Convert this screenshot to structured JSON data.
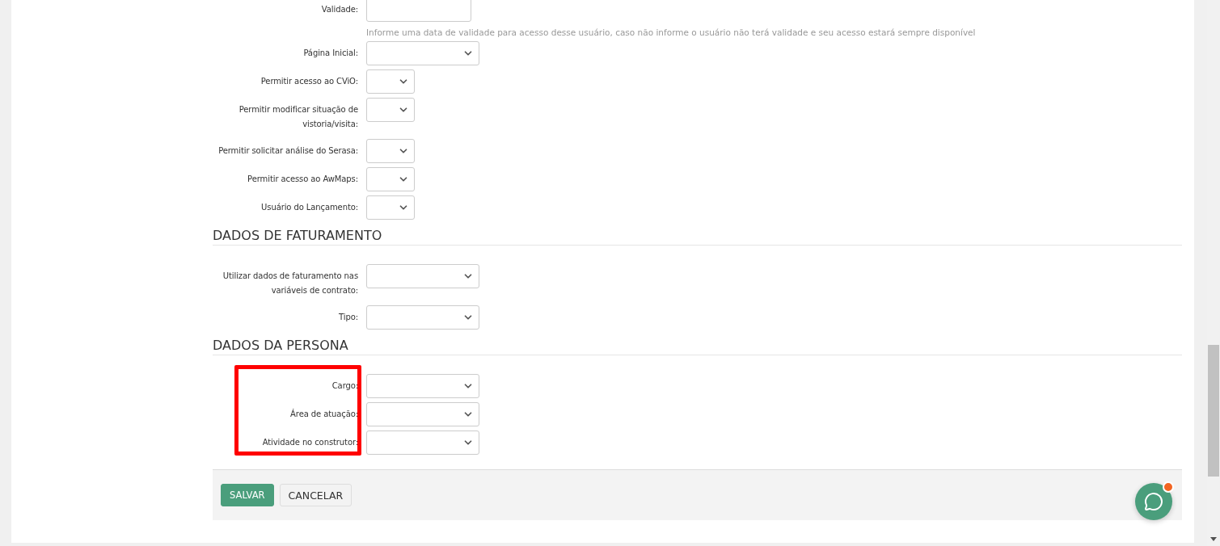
{
  "user_fields": [
    {
      "label": "Validade:",
      "kind": "text",
      "help": "Informe uma data de validade para acesso desse usuário, caso não informe o usuário não terá validade e seu acesso estará sempre disponível"
    },
    {
      "label": "Página Inicial:",
      "kind": "select"
    },
    {
      "label": "Permitir acesso ao CViO:",
      "kind": "short_select"
    },
    {
      "label": "Permitir modificar situação de vistoria/visita:",
      "kind": "short_select"
    },
    {
      "label": "Permitir solicitar análise do Serasa:",
      "kind": "short_select"
    },
    {
      "label": "Permitir acesso ao AwMaps:",
      "kind": "short_select"
    },
    {
      "label": "Usuário do Lançamento:",
      "kind": "short_select"
    }
  ],
  "sections": [
    {
      "title": "DADOS DE FATURAMENTO",
      "highlighted": false,
      "fields": [
        {
          "label": "Utilizar dados de faturamento nas variáveis de contrato:",
          "kind": "select"
        },
        {
          "label": "Tipo:",
          "kind": "select"
        }
      ]
    },
    {
      "title": "DADOS DA PERSONA",
      "highlighted": true,
      "fields": [
        {
          "label": "Cargo:",
          "kind": "select"
        },
        {
          "label": "Área de atuação:",
          "kind": "select"
        },
        {
          "label": "Atividade no construtor:",
          "kind": "select"
        }
      ]
    }
  ],
  "buttons": [
    {
      "label": "SALVAR",
      "kind": "primary"
    },
    {
      "label": "CANCELAR",
      "kind": "secondary"
    }
  ],
  "chat": {
    "notification": true
  }
}
